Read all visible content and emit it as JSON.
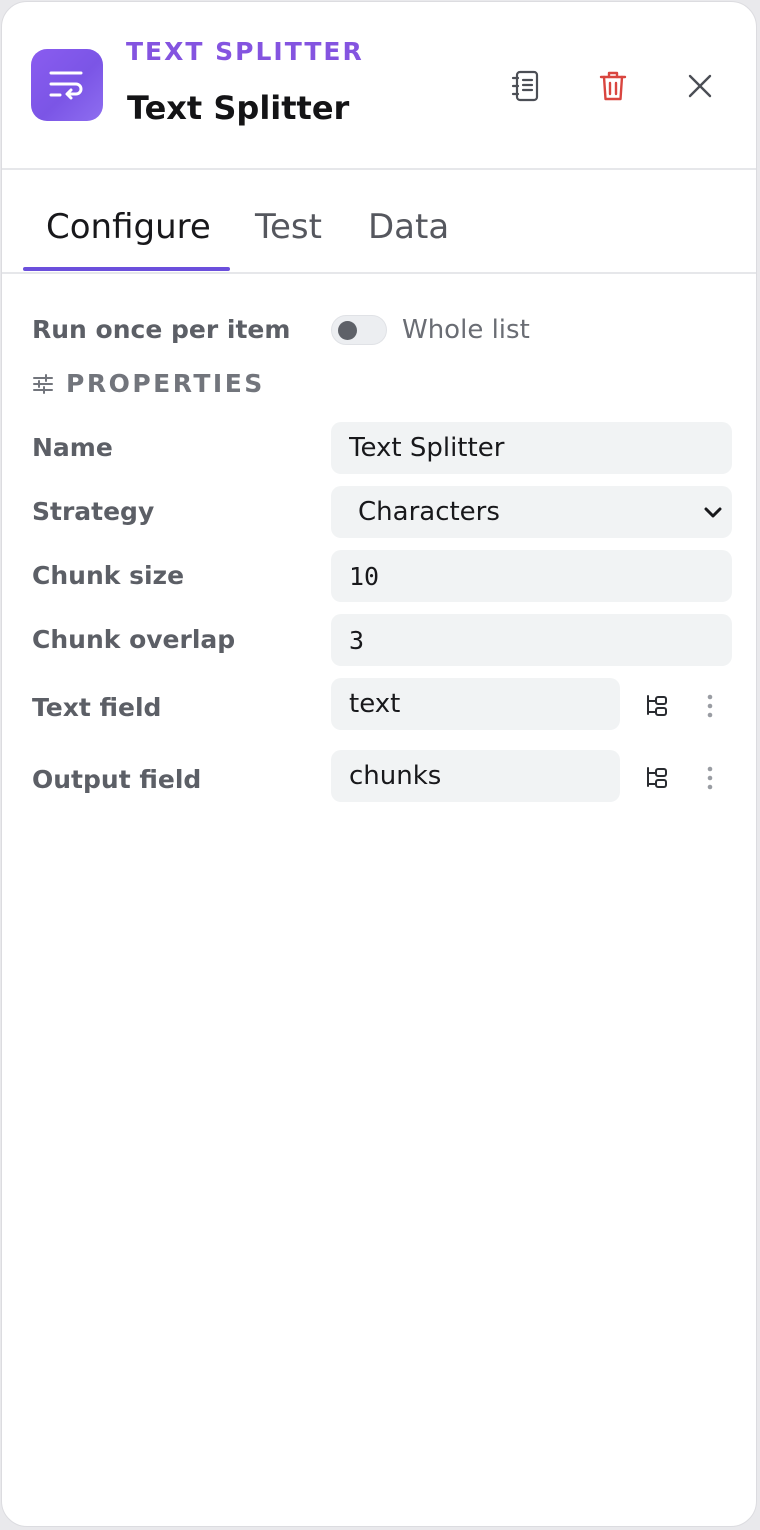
{
  "header": {
    "node_type": "TEXT SPLITTER",
    "node_title": "Text Splitter",
    "node_icon": "text-wrap-icon",
    "actions": [
      {
        "name": "docs",
        "icon": "notebook-icon"
      },
      {
        "name": "delete",
        "icon": "trash-icon",
        "color": "#d9453f"
      },
      {
        "name": "close",
        "icon": "close-icon"
      }
    ]
  },
  "tabs": [
    {
      "label": "Configure",
      "active": true
    },
    {
      "label": "Test",
      "active": false
    },
    {
      "label": "Data",
      "active": false
    }
  ],
  "run_mode": {
    "label": "Run once per item",
    "toggle_label": "Whole list",
    "toggle_on": false
  },
  "properties": {
    "title": "PROPERTIES",
    "icon": "sliders-icon",
    "name": {
      "label": "Name",
      "value": "Text Splitter"
    },
    "strategy": {
      "label": "Strategy",
      "value": "Characters"
    },
    "chunk_size": {
      "label": "Chunk size",
      "value": "10"
    },
    "chunk_overlap": {
      "label": "Chunk overlap",
      "value": "3"
    },
    "text_field": {
      "label": "Text field",
      "value": "text"
    },
    "output_field": {
      "label": "Output field",
      "value": "chunks"
    }
  },
  "colors": {
    "accent": "#6b4fdc",
    "node_type_text": "#8454e0",
    "icon_bg": "#8a5cf0"
  }
}
